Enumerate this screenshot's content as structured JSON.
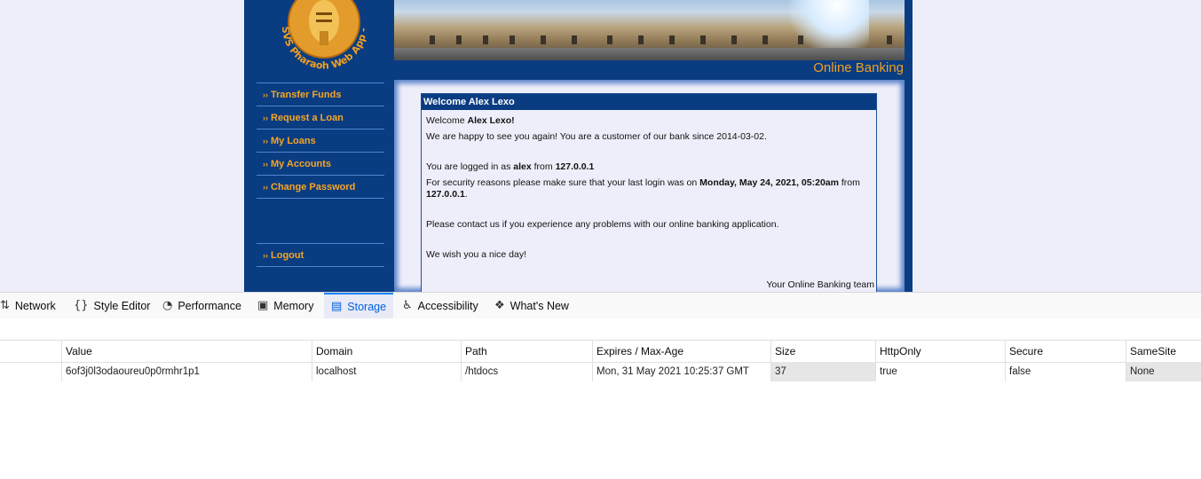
{
  "site": {
    "logo_text": "SVS Pharaoh Web App - A vulnerable Web App",
    "brand_text": "Online Banking",
    "nav": [
      {
        "label": "Transfer Funds",
        "arrow": "››"
      },
      {
        "label": "Request a Loan",
        "arrow": "››"
      },
      {
        "label": "My Loans",
        "arrow": "››"
      },
      {
        "label": "My Accounts",
        "arrow": "››"
      },
      {
        "label": "Change Password",
        "arrow": "››"
      }
    ],
    "logout": {
      "label": "Logout",
      "arrow": "››"
    }
  },
  "welcome": {
    "title": "Welcome Alex Lexo",
    "greeting_prefix": "Welcome ",
    "greeting_name": "Alex Lexo!",
    "line_customer": "We are happy to see you again! You are a customer of our bank since 2014-03-02.",
    "logged_prefix": "You are logged in as ",
    "logged_user": "alex",
    "logged_mid": " from ",
    "logged_ip": "127.0.0.1",
    "security_prefix": "For security reasons please make sure that your last login was on ",
    "security_date": "Monday, May 24, 2021, 05:20am",
    "security_mid": " from",
    "security_ip": "127.0.0.1",
    "security_end": ".",
    "contact": "Please contact us if you experience any problems with our online banking application.",
    "nice_day": "We wish you a nice day!",
    "team": "Your Online Banking team"
  },
  "devtools": {
    "tabs": [
      {
        "label": "Network",
        "icon": "network-icon",
        "glyph": "⇅"
      },
      {
        "label": "Style Editor",
        "icon": "braces-icon",
        "glyph": "{}"
      },
      {
        "label": "Performance",
        "icon": "gauge-icon",
        "glyph": "◔"
      },
      {
        "label": "Memory",
        "icon": "chip-icon",
        "glyph": "▣"
      },
      {
        "label": "Storage",
        "icon": "database-icon",
        "glyph": "▤"
      },
      {
        "label": "Accessibility",
        "icon": "person-icon",
        "glyph": "♿"
      },
      {
        "label": "What's New",
        "icon": "gift-icon",
        "glyph": "❖"
      }
    ],
    "active_tab": "Storage",
    "columns": [
      "Value",
      "Domain",
      "Path",
      "Expires / Max-Age",
      "Size",
      "HttpOnly",
      "Secure",
      "SameSite"
    ],
    "rows": [
      {
        "Value": "6of3j0l3odaoureu0p0rmhr1p1",
        "Domain": "localhost",
        "Path": "/htdocs",
        "Expires": "Mon, 31 May 2021 10:25:37 GMT",
        "Size": "37",
        "HttpOnly": "true",
        "Secure": "false",
        "SameSite": "None"
      }
    ]
  },
  "colors": {
    "site_blue": "#0a3c82",
    "accent_orange": "#f5a623",
    "page_bg": "#eeeefa",
    "devtools_active": "#0060df"
  }
}
